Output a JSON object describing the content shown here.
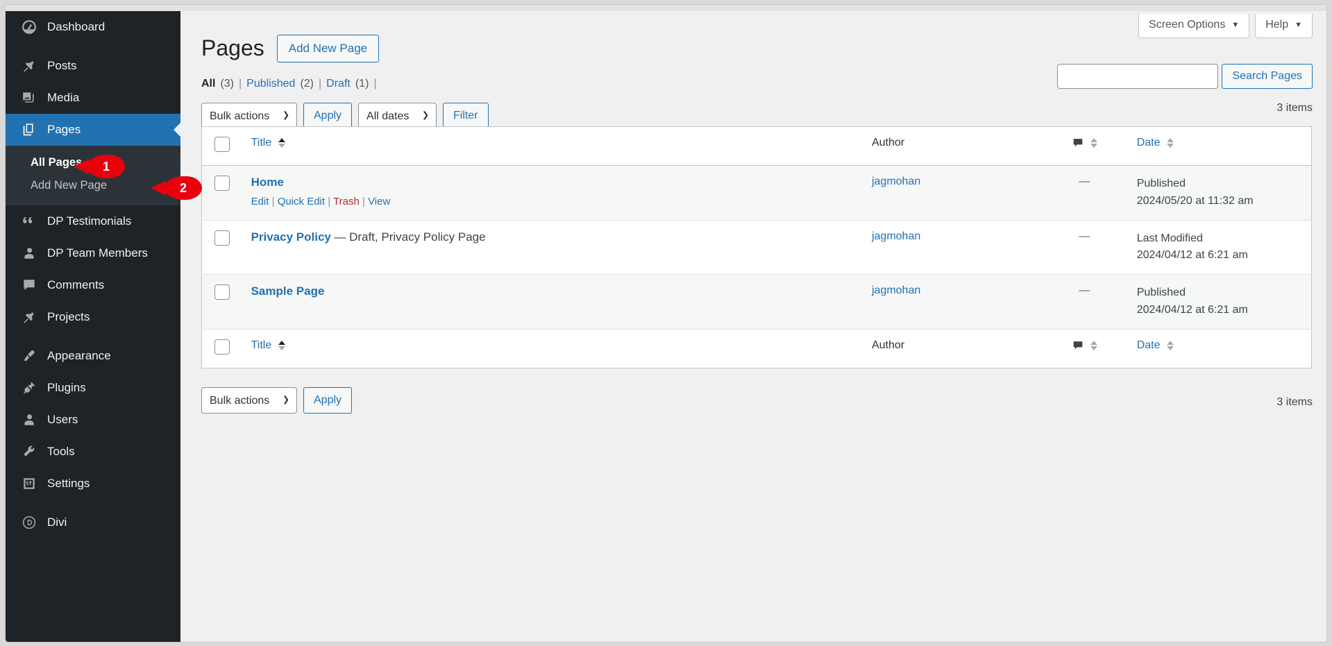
{
  "sidebar": {
    "items": [
      {
        "label": "Dashboard",
        "icon": "dashboard-icon",
        "current": false
      },
      {
        "label": "Posts",
        "icon": "pin-icon",
        "current": false
      },
      {
        "label": "Media",
        "icon": "media-icon",
        "current": false
      },
      {
        "label": "Pages",
        "icon": "pages-icon",
        "current": true
      },
      {
        "label": "DP Testimonials",
        "icon": "quote-icon",
        "current": false
      },
      {
        "label": "DP Team Members",
        "icon": "user-icon",
        "current": false
      },
      {
        "label": "Comments",
        "icon": "comment-icon",
        "current": false
      },
      {
        "label": "Projects",
        "icon": "pin-icon",
        "current": false
      },
      {
        "label": "Appearance",
        "icon": "brush-icon",
        "current": false
      },
      {
        "label": "Plugins",
        "icon": "plug-icon",
        "current": false
      },
      {
        "label": "Users",
        "icon": "user-icon",
        "current": false
      },
      {
        "label": "Tools",
        "icon": "wrench-icon",
        "current": false
      },
      {
        "label": "Settings",
        "icon": "sliders-icon",
        "current": false
      },
      {
        "label": "Divi",
        "icon": "divi-icon",
        "current": false
      }
    ],
    "submenu": {
      "all_pages": "All Pages",
      "add_new_page": "Add New Page"
    }
  },
  "callouts": [
    {
      "number": "1"
    },
    {
      "number": "2"
    }
  ],
  "screen_meta": {
    "screen_options": "Screen Options",
    "help": "Help",
    "caret": "▼"
  },
  "header": {
    "title": "Pages",
    "add_new_button": "Add New Page"
  },
  "status_links": {
    "all_label": "All",
    "all_count": "(3)",
    "published_label": "Published",
    "published_count": "(2)",
    "draft_label": "Draft",
    "draft_count": "(1)",
    "separator": "|"
  },
  "search": {
    "value": "",
    "placeholder": "",
    "button": "Search Pages"
  },
  "tablenav_top": {
    "bulk_actions": "Bulk actions",
    "apply": "Apply",
    "all_dates": "All dates",
    "filter": "Filter",
    "items_count": "3 items"
  },
  "tablenav_bottom": {
    "bulk_actions": "Bulk actions",
    "apply": "Apply",
    "items_count": "3 items"
  },
  "table": {
    "columns": {
      "title": "Title",
      "author": "Author",
      "comments": "comment-icon",
      "date": "Date"
    },
    "rows": [
      {
        "title": "Home",
        "status_suffix": "",
        "author": "jagmohan",
        "comments": "—",
        "date_label": "Published",
        "date_value": "2024/05/20 at 11:32 am",
        "actions": {
          "edit": "Edit",
          "quick_edit": "Quick Edit",
          "trash": "Trash",
          "view": "View",
          "sep": "|"
        }
      },
      {
        "title": "Privacy Policy",
        "status_suffix": "— Draft, Privacy Policy Page",
        "author": "jagmohan",
        "comments": "—",
        "date_label": "Last Modified",
        "date_value": "2024/04/12 at 6:21 am",
        "actions": null
      },
      {
        "title": "Sample Page",
        "status_suffix": "",
        "author": "jagmohan",
        "comments": "—",
        "date_label": "Published",
        "date_value": "2024/04/12 at 6:21 am",
        "actions": null
      }
    ]
  },
  "colors": {
    "sidebar_bg": "#1d2327",
    "submenu_bg": "#2c3338",
    "current_menu": "#2271b1",
    "link_blue": "#2271b1",
    "trash_red": "#b32d2e",
    "callout_red": "#e8000d",
    "page_bg": "#f0f0f1"
  }
}
